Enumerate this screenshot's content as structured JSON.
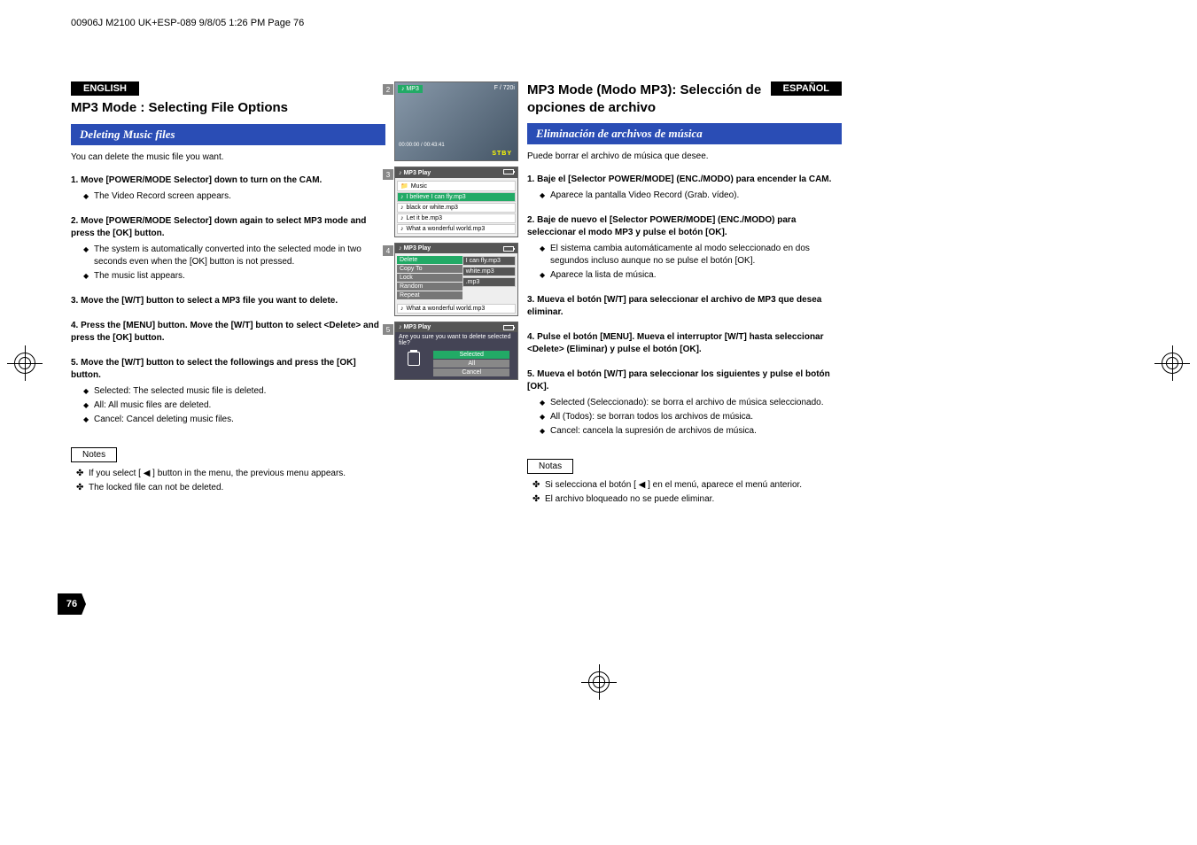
{
  "header_bar": "00906J M2100 UK+ESP-089  9/8/05 1:26 PM  Page 76",
  "page_number": "76",
  "left": {
    "lang": "ENGLISH",
    "title": "MP3 Mode : Selecting File Options",
    "blue": "Deleting Music files",
    "intro": "You can delete the music file you want.",
    "s1h": "1.  Move [POWER/MODE Selector] down to turn on the CAM.",
    "s1b1": "The Video Record screen appears.",
    "s2h": "2.  Move [POWER/MODE Selector] down again to select MP3 mode and press the [OK] button.",
    "s2b1": "The system is automatically converted into the selected mode in two seconds even when the [OK] button is not pressed.",
    "s2b2": "The music list appears.",
    "s3h": "3.  Move the [W/T] button to select a MP3 file you want to delete.",
    "s4h": "4.  Press the [MENU] button. Move the [W/T] button to select <Delete> and press the [OK] button.",
    "s5h": "5.  Move the [W/T] button to select the followings and press the [OK] button.",
    "s5b1": "Selected: The selected music file is deleted.",
    "s5b2": "All: All music files are deleted.",
    "s5b3": "Cancel: Cancel deleting music files.",
    "notes_label": "Notes",
    "n1": "If you select [ ◀ ] button in the menu, the previous menu appears.",
    "n2": "The locked file can not be deleted."
  },
  "right": {
    "lang": "ESPAÑOL",
    "title": "MP3 Mode (Modo MP3): Selección de opciones de archivo",
    "blue": "Eliminación de archivos de música",
    "intro": "Puede borrar el archivo de música que desee.",
    "s1h": "1.  Baje el [Selector POWER/MODE] (ENC./MODO) para encender la CAM.",
    "s1b1": "Aparece la pantalla Video Record (Grab. vídeo).",
    "s2h": "2.  Baje de nuevo el [Selector POWER/MODE] (ENC./MODO) para seleccionar el modo MP3 y pulse el botón [OK].",
    "s2b1": "El sistema cambia automáticamente al modo seleccionado en dos segundos incluso aunque no se pulse el botón [OK].",
    "s2b2": "Aparece la lista de música.",
    "s3h": "3.  Mueva el botón [W/T] para seleccionar el archivo de MP3 que desea eliminar.",
    "s4h": "4.  Pulse el botón [MENU]. Mueva el interruptor [W/T] hasta seleccionar <Delete> (Eliminar) y pulse el botón [OK].",
    "s5h": "5.  Mueva el botón [W/T] para seleccionar los siguientes y pulse el botón [OK].",
    "s5b1": "Selected (Seleccionado): se borra el archivo de música seleccionado.",
    "s5b2": "All (Todos): se borran todos los archivos de música.",
    "s5b3": "Cancel: cancela la supresión de archivos de música.",
    "notes_label": "Notas",
    "n1": "Si selecciona el botón [ ◀ ] en el menú, aparece el menú anterior.",
    "n2": "El archivo bloqueado no se puede eliminar."
  },
  "screens": {
    "s2": {
      "num": "2",
      "mode": "MP3",
      "stby": "STBY",
      "time": "00:00:00 / 00:43:41",
      "fine": "F / 720i"
    },
    "s3": {
      "num": "3",
      "title": "MP3 Play",
      "folder": "Music",
      "r1": "I believe I can fly.mp3",
      "r2": "black or white.mp3",
      "r3": "Let it be.mp3",
      "r4": "What a wonderful world.mp3"
    },
    "s4": {
      "num": "4",
      "title": "MP3 Play",
      "m1": "Delete",
      "m2": "Copy To",
      "m3": "Lock",
      "m4": "Random",
      "m5": "Repeat",
      "r1": "I can fly.mp3",
      "r2": "white.mp3",
      "r3": ".mp3",
      "last": "What a wonderful world.mp3"
    },
    "s5": {
      "num": "5",
      "title": "MP3 Play",
      "confirm": "Are you sure you want to delete selected file?",
      "opt1": "Selected",
      "opt2": "All",
      "opt3": "Cancel"
    }
  }
}
